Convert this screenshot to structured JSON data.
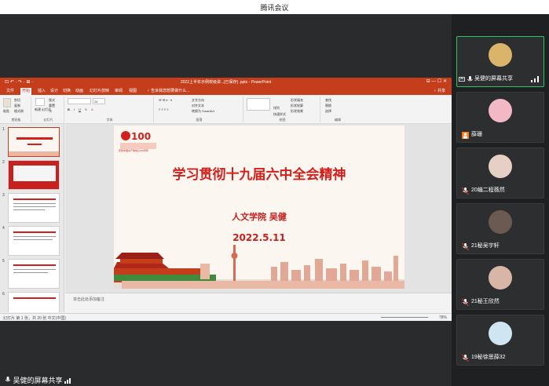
{
  "app": {
    "title": "腾讯会议"
  },
  "screen_share": {
    "label": "吴健的屏幕共享",
    "window_title": "2022上半年示例校级讲...[已保存] .pptx - PowerPoint",
    "quick_access": "⊡ ↶ · ↷ · ⊞ ·",
    "window_controls": "⊟  —  ☐  ✕",
    "tabs": [
      "文件",
      "开始",
      "插入",
      "设计",
      "切换",
      "动画",
      "幻灯片放映",
      "审阅",
      "视图",
      "♀ 告诉我您想要做什么..."
    ],
    "ribbon": {
      "groups": [
        "剪贴板",
        "幻灯片",
        "字体",
        "段落",
        "绘图",
        "编辑"
      ],
      "clipboard_items": [
        "剪切",
        "复制",
        "格式刷"
      ],
      "paste_label": "粘贴",
      "new_slide_label": "新建\n幻灯片",
      "slide_items": [
        "版式",
        "重置",
        "节"
      ],
      "font_size": "24",
      "paragraph_items": [
        "文字方向",
        "对齐文本",
        "转换为 SmartArt"
      ],
      "drawing_items": [
        "形状填充",
        "形状轮廓",
        "形状效果"
      ],
      "editing_items": [
        "查找",
        "替换",
        "选择"
      ],
      "arrange_label": "排列",
      "quick_styles_label": "快速样式"
    },
    "share_btn": "♀ 共享",
    "thumb_numbers": [
      "1",
      "2",
      "3",
      "4",
      "5",
      "6"
    ],
    "slide": {
      "logo_text": "庆祝中国共产党成立100周年",
      "title": "学习贯彻十九届六中全会精神",
      "author": "人文学院    吴健",
      "date": "2022.5.11"
    },
    "notes_placeholder": "单击此处添加备注",
    "status_left": "幻灯片 第 1 张，共 20 张    中文(中国)",
    "status_right": "78%"
  },
  "participants": [
    {
      "name": "吴健的屏幕共享",
      "avatar_color": "#d9b46a",
      "active": true
    },
    {
      "name": "薛珊",
      "avatar_color": "#f2b8c6",
      "active": false
    },
    {
      "name": "20编二程薇然",
      "avatar_color": "#e6cfc4",
      "active": false
    },
    {
      "name": "21秘吴宇轩",
      "avatar_color": "#6b5a52",
      "active": false
    },
    {
      "name": "21秘王欣然",
      "avatar_color": "#d7b6a7",
      "active": false
    },
    {
      "name": "19秘徐思薛32",
      "avatar_color": "#cfe6f2",
      "active": false
    }
  ],
  "colors": {
    "accent_green": "#27c26a",
    "ppt_red": "#c43e1c",
    "slide_red": "#d3201c"
  }
}
